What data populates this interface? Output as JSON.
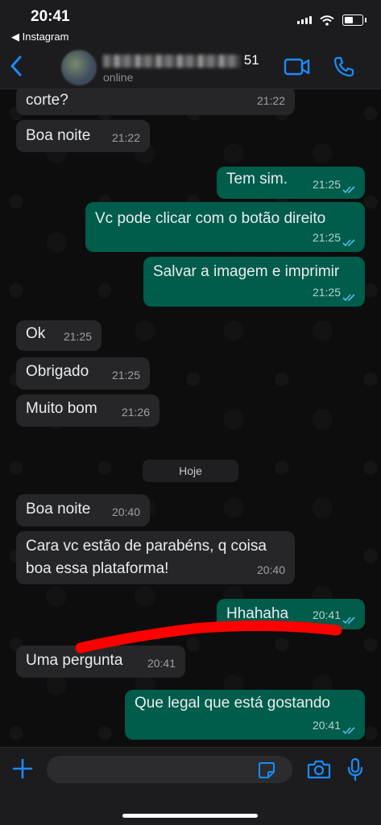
{
  "status_bar": {
    "time": "20:41",
    "back_app": "◀ Instagram"
  },
  "header": {
    "contact_name_suffix": "51",
    "presence": "online"
  },
  "messages": [
    {
      "text": "corte?",
      "time": "21:22"
    },
    {
      "text": "Boa noite",
      "time": "21:22"
    },
    {
      "text": "Tem sim.",
      "time": "21:25"
    },
    {
      "text": "Vc pode clicar com o botão direito",
      "time": "21:25"
    },
    {
      "text": "Salvar a imagem e imprimir",
      "time": "21:25"
    },
    {
      "text": "Ok",
      "time": "21:25"
    },
    {
      "text": "Obrigado",
      "time": "21:25"
    },
    {
      "text": "Muito bom",
      "time": "21:26"
    },
    {
      "text": "Boa noite",
      "time": "20:40"
    },
    {
      "text_line1": "Cara vc estão de parabéns, q coisa",
      "text_line2": "boa essa plataforma!",
      "time": "20:40"
    },
    {
      "text": "Hhahaha",
      "time": "20:41"
    },
    {
      "text": "Uma pergunta",
      "time": "20:41"
    },
    {
      "text": "Que legal que está gostando",
      "time": "20:41"
    }
  ],
  "day_divider": "Hoje",
  "icons": {
    "back": "chevron-left-icon",
    "video": "video-call-icon",
    "phone": "phone-call-icon",
    "plus": "plus-icon",
    "sticker": "sticker-icon",
    "camera": "camera-icon",
    "mic": "microphone-icon",
    "read_receipt": "double-check-icon"
  },
  "colors": {
    "accent": "#1a8cff",
    "outgoing_bubble": "#005c4b",
    "incoming_bubble": "#262628",
    "read_ticks": "#53bdeb",
    "redaction_mark": "#ff0000"
  }
}
